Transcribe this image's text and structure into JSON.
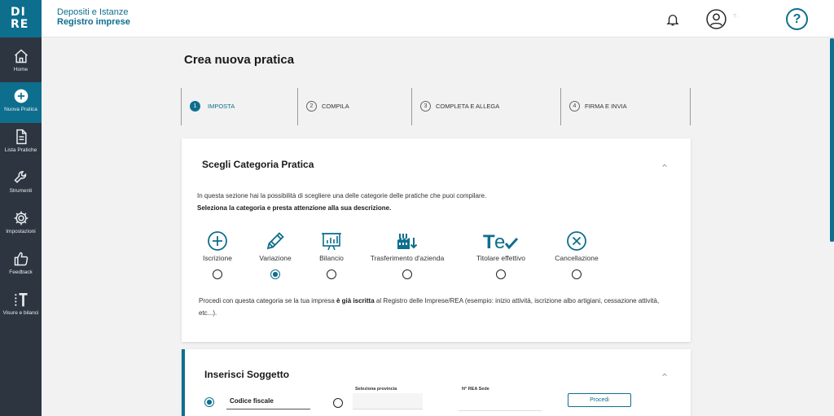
{
  "app": {
    "logo_line1": "DI",
    "logo_line2": "RE",
    "subtitle": "Depositi e Istanze",
    "title": "Registro imprese",
    "user_name": "T·",
    "help_symbol": "?"
  },
  "sidebar": {
    "items": [
      {
        "label": "Home",
        "icon": "home-icon",
        "active": false
      },
      {
        "label": "Nuova Pratica",
        "icon": "plus-circle-icon",
        "active": true
      },
      {
        "label": "Lista Pratiche",
        "icon": "document-icon",
        "active": false
      },
      {
        "label": "Strumenti",
        "icon": "wrench-icon",
        "active": false
      },
      {
        "label": "Impostazioni",
        "icon": "gear-icon",
        "active": false
      },
      {
        "label": "Feedback",
        "icon": "thumbs-up-icon",
        "active": false
      },
      {
        "label": "Visure e bilanci",
        "icon": "visure-icon",
        "active": false
      }
    ]
  },
  "page": {
    "title": "Crea nuova pratica"
  },
  "stepper": {
    "steps": [
      {
        "num": "1",
        "label": "IMPOSTA",
        "active": true
      },
      {
        "num": "2",
        "label": "COMPILA",
        "active": false
      },
      {
        "num": "3",
        "label": "COMPLETA E ALLEGA",
        "active": false
      },
      {
        "num": "4",
        "label": "FIRMA E INVIA",
        "active": false
      }
    ]
  },
  "categoria": {
    "title": "Scegli Categoria Pratica",
    "intro": "In questa sezione hai la possibilità di scegliere una delle categorie delle pratiche che puoi compilare.",
    "intro_bold": "Seleziona la categoria e presta attenzione alla sua descrizione.",
    "options": [
      {
        "label": "Iscrizione",
        "icon": "plus-circle-icon",
        "selected": false
      },
      {
        "label": "Variazione",
        "icon": "pencil-icon",
        "selected": true
      },
      {
        "label": "Bilancio",
        "icon": "chart-board-icon",
        "selected": false
      },
      {
        "label": "Trasferimento d'azienda",
        "icon": "factory-transfer-icon",
        "selected": false
      },
      {
        "label": "Titolare effettivo",
        "icon": "te-check-icon",
        "selected": false
      },
      {
        "label": "Cancellazione",
        "icon": "x-circle-icon",
        "selected": false
      }
    ],
    "desc_part1": "Procedi con questa categoria se la tua impresa ",
    "desc_bold": "è già iscritta",
    "desc_part2": " al Registro delle Imprese/REA (esempio: inizio attività, iscrizione albo artigiani, cessazione attività, etc...)."
  },
  "soggetto": {
    "title": "Inserisci Soggetto",
    "codice_fiscale": "Codice fiscale",
    "provincia_label": "Seleziona provincia",
    "rea_label": "N° REA Sede",
    "procedi": "Procedi"
  },
  "colors": {
    "brand": "#0e6e8e",
    "sidebar": "#2d3640"
  }
}
